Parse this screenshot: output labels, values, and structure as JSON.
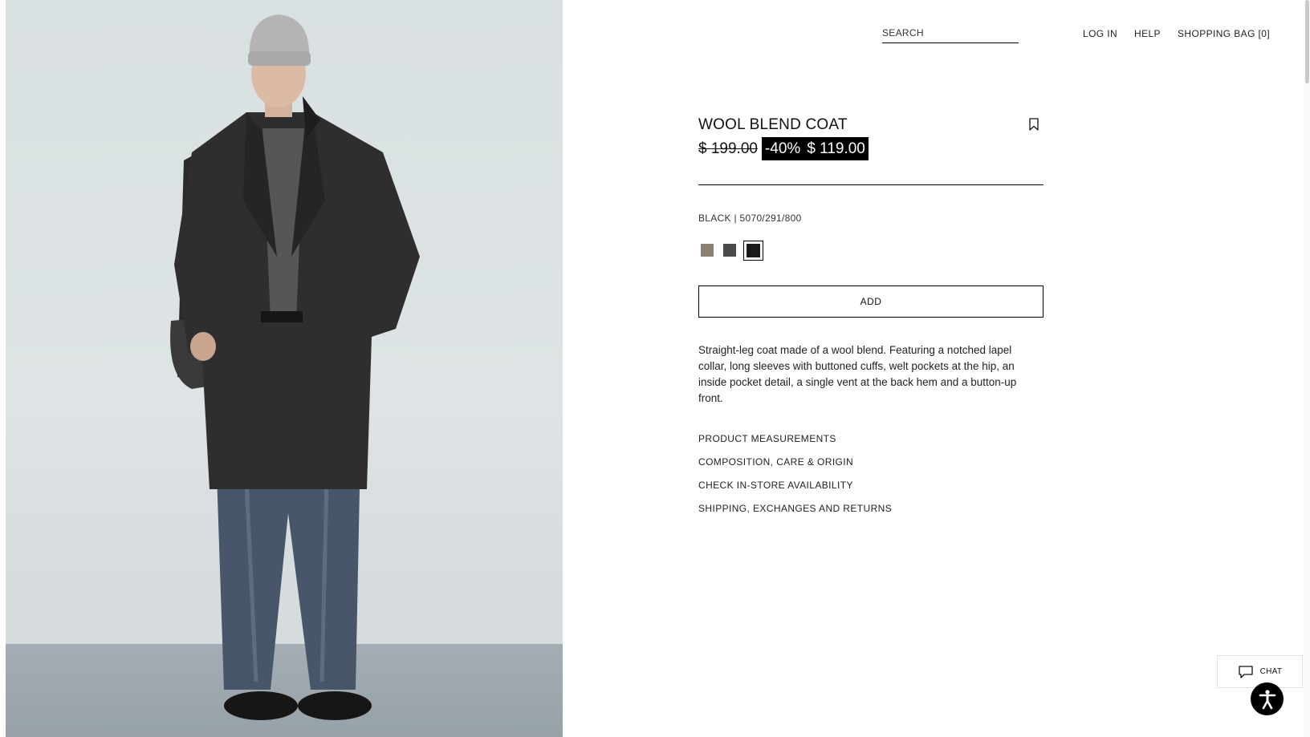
{
  "header": {
    "search_placeholder": "SEARCH",
    "log_in": "LOG IN",
    "help": "HELP",
    "shopping_bag": "SHOPPING BAG [0]"
  },
  "product": {
    "title": "WOOL BLEND COAT",
    "old_price": "$ 199.00",
    "discount": "-40%",
    "new_price": "$ 119.00",
    "color_ref": "BLACK | 5070/291/800",
    "swatches": [
      {
        "color": "#8b8072",
        "selected": false
      },
      {
        "color": "#4a4b4d",
        "selected": false
      },
      {
        "color": "#1a1a1a",
        "selected": true
      }
    ],
    "add_label": "ADD",
    "description": "Straight-leg coat made of a wool blend. Featuring a notched lapel collar, long sleeves with buttoned cuffs, welt pockets at the hip, an inside pocket detail, a single vent at the back hem and a button-up front.",
    "links": [
      "PRODUCT MEASUREMENTS",
      "COMPOSITION, CARE & ORIGIN",
      "CHECK IN-STORE AVAILABILITY",
      "SHIPPING, EXCHANGES AND RETURNS"
    ]
  },
  "chat": {
    "label": "CHAT"
  },
  "icons": {
    "bookmark": "bookmark-icon",
    "chat": "chat-bubble-icon",
    "accessibility": "accessibility-icon"
  }
}
